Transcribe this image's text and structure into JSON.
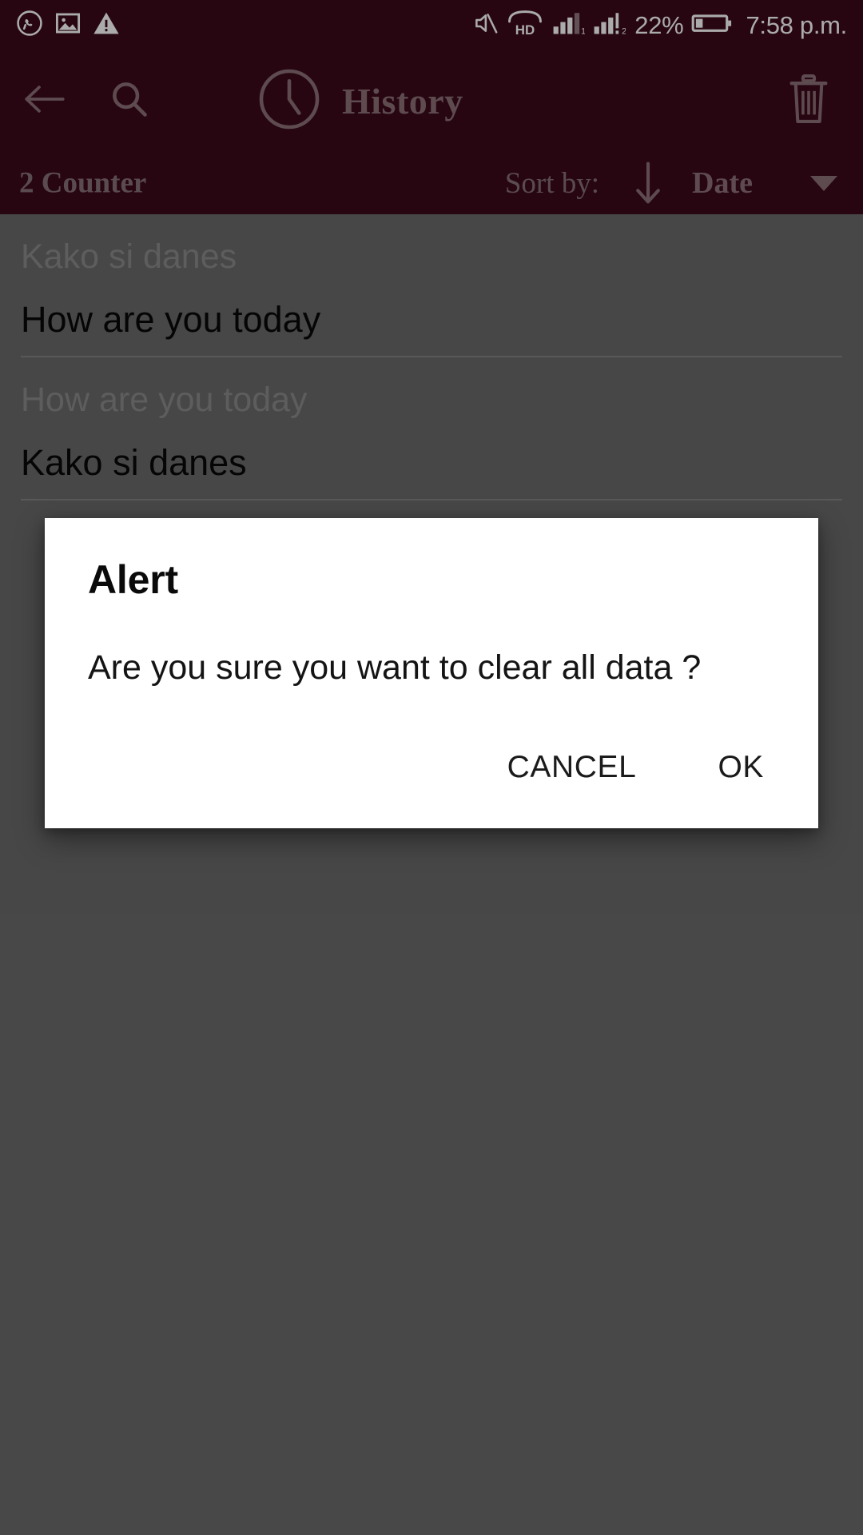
{
  "status_bar": {
    "left_icons": [
      "whatsapp-icon",
      "image-icon",
      "warning-icon"
    ],
    "right_icons": [
      "mute-icon",
      "hd-call-icon",
      "signal-1-icon",
      "signal-2-icon",
      "battery-icon"
    ],
    "battery_percent": "22%",
    "time": "7:58 p.m."
  },
  "app_bar": {
    "back_icon": "back-arrow-icon",
    "search_icon": "search-icon",
    "clock_icon": "clock-icon",
    "title": "History",
    "delete_icon": "trash-icon"
  },
  "sub_bar": {
    "counter": "2 Counter",
    "sort_label": "Sort by:",
    "sort_direction_icon": "arrow-down-icon",
    "sort_value": "Date",
    "dropdown_icon": "caret-down-icon"
  },
  "history": {
    "items": [
      {
        "source": "Kako si danes",
        "translation": "How are you today"
      },
      {
        "source": "How are you today",
        "translation": "Kako si danes"
      }
    ]
  },
  "dialog": {
    "title": "Alert",
    "message": "Are you sure you want to clear all data ?",
    "cancel_label": "CANCEL",
    "ok_label": "OK"
  },
  "colors": {
    "app_bar_bg": "#3b0a1c",
    "app_bar_text": "#8c7078",
    "page_bg": "#6b6b6b",
    "dialog_bg": "#ffffff",
    "primary_text": "#080808",
    "secondary_text": "#8b8b8b"
  }
}
